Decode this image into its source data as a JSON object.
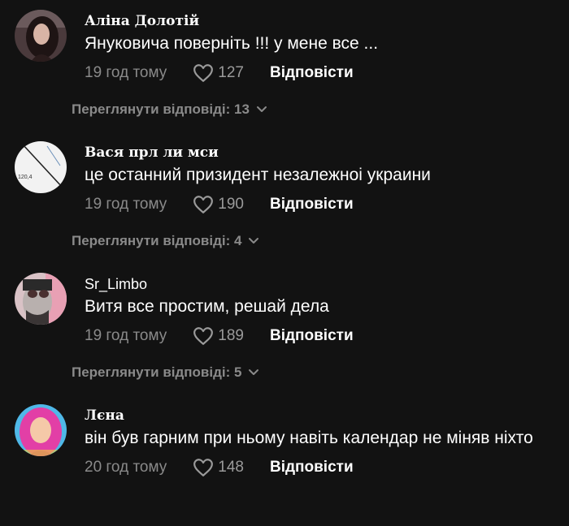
{
  "comments": [
    {
      "username": "Аліна Долотій",
      "avatar": "profile-photo-woman-dark-hair",
      "text": "Януковича поверніть !!! у мене все ...",
      "time": "19 год тому",
      "likes": "127",
      "reply_label": "Відповісти",
      "view_replies": "Переглянути відповіді: 13"
    },
    {
      "username": "Вася прл ли мси",
      "avatar": "sketch-drawing-120.4",
      "avatar_text": "120,4",
      "text": "це останний призидент незалежноі украини",
      "time": "19 год тому",
      "likes": "190",
      "reply_label": "Відповісти",
      "view_replies": "Переглянути відповіді: 4"
    },
    {
      "username": "Sr_Limbo",
      "avatar": "man-portrait-pink-background",
      "text": "Витя все простим, решай дела",
      "time": "19 год тому",
      "likes": "189",
      "reply_label": "Відповісти",
      "view_replies": "Переглянути відповіді: 5"
    },
    {
      "username": "Лєна",
      "avatar": "woman-pink-hair-portrait",
      "text": "він був гарним при ньому навіть календар не міняв ніхто",
      "time": "20 год тому",
      "likes": "148",
      "reply_label": "Відповісти"
    }
  ],
  "colors": {
    "background": "#121212",
    "text": "#ffffff",
    "muted": "#8a8a8a"
  },
  "icons": {
    "like": "heart-outline-icon",
    "expand": "chevron-down-icon"
  }
}
